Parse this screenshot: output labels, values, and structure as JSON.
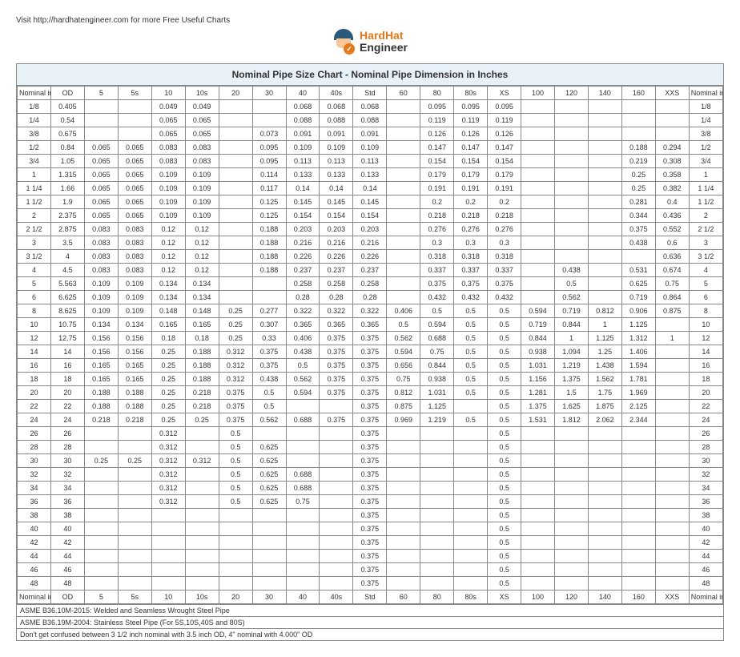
{
  "visit_text": "Visit http://hardhatengineer.com for more Free Useful Charts",
  "logo": {
    "line1": "HardHat",
    "line2": "Engineer"
  },
  "title": "Nominal Pipe Size Chart - Nominal Pipe Dimension in Inches",
  "headers": [
    "Nominal in Inch",
    "OD",
    "5",
    "5s",
    "10",
    "10s",
    "20",
    "30",
    "40",
    "40s",
    "Std",
    "60",
    "80",
    "80s",
    "XS",
    "100",
    "120",
    "140",
    "160",
    "XXS",
    "Nominal in Inch"
  ],
  "rows": [
    [
      "1/8",
      "0.405",
      "",
      "",
      "0.049",
      "0.049",
      "",
      "",
      "0.068",
      "0.068",
      "0.068",
      "",
      "0.095",
      "0.095",
      "0.095",
      "",
      "",
      "",
      "",
      "",
      "1/8"
    ],
    [
      "1/4",
      "0.54",
      "",
      "",
      "0.065",
      "0.065",
      "",
      "",
      "0.088",
      "0.088",
      "0.088",
      "",
      "0.119",
      "0.119",
      "0.119",
      "",
      "",
      "",
      "",
      "",
      "1/4"
    ],
    [
      "3/8",
      "0.675",
      "",
      "",
      "0.065",
      "0.065",
      "",
      "0.073",
      "0.091",
      "0.091",
      "0.091",
      "",
      "0.126",
      "0.126",
      "0.126",
      "",
      "",
      "",
      "",
      "",
      "3/8"
    ],
    [
      "1/2",
      "0.84",
      "0.065",
      "0.065",
      "0.083",
      "0.083",
      "",
      "0.095",
      "0.109",
      "0.109",
      "0.109",
      "",
      "0.147",
      "0.147",
      "0.147",
      "",
      "",
      "",
      "0.188",
      "0.294",
      "1/2"
    ],
    [
      "3/4",
      "1.05",
      "0.065",
      "0.065",
      "0.083",
      "0.083",
      "",
      "0.095",
      "0.113",
      "0.113",
      "0.113",
      "",
      "0.154",
      "0.154",
      "0.154",
      "",
      "",
      "",
      "0.219",
      "0.308",
      "3/4"
    ],
    [
      "1",
      "1.315",
      "0.065",
      "0.065",
      "0.109",
      "0.109",
      "",
      "0.114",
      "0.133",
      "0.133",
      "0.133",
      "",
      "0.179",
      "0.179",
      "0.179",
      "",
      "",
      "",
      "0.25",
      "0.358",
      "1"
    ],
    [
      "1 1/4",
      "1.66",
      "0.065",
      "0.065",
      "0.109",
      "0.109",
      "",
      "0.117",
      "0.14",
      "0.14",
      "0.14",
      "",
      "0.191",
      "0.191",
      "0.191",
      "",
      "",
      "",
      "0.25",
      "0.382",
      "1 1/4"
    ],
    [
      "1 1/2",
      "1.9",
      "0.065",
      "0.065",
      "0.109",
      "0.109",
      "",
      "0.125",
      "0.145",
      "0.145",
      "0.145",
      "",
      "0.2",
      "0.2",
      "0.2",
      "",
      "",
      "",
      "0.281",
      "0.4",
      "1 1/2"
    ],
    [
      "2",
      "2.375",
      "0.065",
      "0.065",
      "0.109",
      "0.109",
      "",
      "0.125",
      "0.154",
      "0.154",
      "0.154",
      "",
      "0.218",
      "0.218",
      "0.218",
      "",
      "",
      "",
      "0.344",
      "0.436",
      "2"
    ],
    [
      "2 1/2",
      "2.875",
      "0.083",
      "0.083",
      "0.12",
      "0.12",
      "",
      "0.188",
      "0.203",
      "0.203",
      "0.203",
      "",
      "0.276",
      "0.276",
      "0.276",
      "",
      "",
      "",
      "0.375",
      "0.552",
      "2 1/2"
    ],
    [
      "3",
      "3.5",
      "0.083",
      "0.083",
      "0.12",
      "0.12",
      "",
      "0.188",
      "0.216",
      "0.216",
      "0.216",
      "",
      "0.3",
      "0.3",
      "0.3",
      "",
      "",
      "",
      "0.438",
      "0.6",
      "3"
    ],
    [
      "3 1/2",
      "4",
      "0.083",
      "0.083",
      "0.12",
      "0.12",
      "",
      "0.188",
      "0.226",
      "0.226",
      "0.226",
      "",
      "0.318",
      "0.318",
      "0.318",
      "",
      "",
      "",
      "",
      "0.636",
      "3 1/2"
    ],
    [
      "4",
      "4.5",
      "0.083",
      "0.083",
      "0.12",
      "0.12",
      "",
      "0.188",
      "0.237",
      "0.237",
      "0.237",
      "",
      "0.337",
      "0.337",
      "0.337",
      "",
      "0.438",
      "",
      "0.531",
      "0.674",
      "4"
    ],
    [
      "5",
      "5.563",
      "0.109",
      "0.109",
      "0.134",
      "0.134",
      "",
      "",
      "0.258",
      "0.258",
      "0.258",
      "",
      "0.375",
      "0.375",
      "0.375",
      "",
      "0.5",
      "",
      "0.625",
      "0.75",
      "5"
    ],
    [
      "6",
      "6.625",
      "0.109",
      "0.109",
      "0.134",
      "0.134",
      "",
      "",
      "0.28",
      "0.28",
      "0.28",
      "",
      "0.432",
      "0.432",
      "0.432",
      "",
      "0.562",
      "",
      "0.719",
      "0.864",
      "6"
    ],
    [
      "8",
      "8.625",
      "0.109",
      "0.109",
      "0.148",
      "0.148",
      "0.25",
      "0.277",
      "0.322",
      "0.322",
      "0.322",
      "0.406",
      "0.5",
      "0.5",
      "0.5",
      "0.594",
      "0.719",
      "0.812",
      "0.906",
      "0.875",
      "8"
    ],
    [
      "10",
      "10.75",
      "0.134",
      "0.134",
      "0.165",
      "0.165",
      "0.25",
      "0.307",
      "0.365",
      "0.365",
      "0.365",
      "0.5",
      "0.594",
      "0.5",
      "0.5",
      "0.719",
      "0.844",
      "1",
      "1.125",
      "",
      "10"
    ],
    [
      "12",
      "12.75",
      "0.156",
      "0.156",
      "0.18",
      "0.18",
      "0.25",
      "0.33",
      "0.406",
      "0.375",
      "0.375",
      "0.562",
      "0.688",
      "0.5",
      "0.5",
      "0.844",
      "1",
      "1.125",
      "1.312",
      "1",
      "12"
    ],
    [
      "14",
      "14",
      "0.156",
      "0.156",
      "0.25",
      "0.188",
      "0.312",
      "0.375",
      "0.438",
      "0.375",
      "0.375",
      "0.594",
      "0.75",
      "0.5",
      "0.5",
      "0.938",
      "1.094",
      "1.25",
      "1.406",
      "",
      "14"
    ],
    [
      "16",
      "16",
      "0.165",
      "0.165",
      "0.25",
      "0.188",
      "0.312",
      "0.375",
      "0.5",
      "0.375",
      "0.375",
      "0.656",
      "0.844",
      "0.5",
      "0.5",
      "1.031",
      "1.219",
      "1.438",
      "1.594",
      "",
      "16"
    ],
    [
      "18",
      "18",
      "0.165",
      "0.165",
      "0.25",
      "0.188",
      "0.312",
      "0.438",
      "0.562",
      "0.375",
      "0.375",
      "0.75",
      "0.938",
      "0.5",
      "0.5",
      "1.156",
      "1.375",
      "1.562",
      "1.781",
      "",
      "18"
    ],
    [
      "20",
      "20",
      "0.188",
      "0.188",
      "0.25",
      "0.218",
      "0.375",
      "0.5",
      "0.594",
      "0.375",
      "0.375",
      "0.812",
      "1.031",
      "0.5",
      "0.5",
      "1.281",
      "1.5",
      "1.75",
      "1.969",
      "",
      "20"
    ],
    [
      "22",
      "22",
      "0.188",
      "0.188",
      "0.25",
      "0.218",
      "0.375",
      "0.5",
      "",
      "",
      "0.375",
      "0.875",
      "1.125",
      "",
      "0.5",
      "1.375",
      "1.625",
      "1.875",
      "2.125",
      "",
      "22"
    ],
    [
      "24",
      "24",
      "0.218",
      "0.218",
      "0.25",
      "0.25",
      "0.375",
      "0.562",
      "0.688",
      "0.375",
      "0.375",
      "0.969",
      "1.219",
      "0.5",
      "0.5",
      "1.531",
      "1.812",
      "2.062",
      "2.344",
      "",
      "24"
    ],
    [
      "26",
      "26",
      "",
      "",
      "0.312",
      "",
      "0.5",
      "",
      "",
      "",
      "0.375",
      "",
      "",
      "",
      "0.5",
      "",
      "",
      "",
      "",
      "",
      "26"
    ],
    [
      "28",
      "28",
      "",
      "",
      "0.312",
      "",
      "0.5",
      "0.625",
      "",
      "",
      "0.375",
      "",
      "",
      "",
      "0.5",
      "",
      "",
      "",
      "",
      "",
      "28"
    ],
    [
      "30",
      "30",
      "0.25",
      "0.25",
      "0.312",
      "0.312",
      "0.5",
      "0.625",
      "",
      "",
      "0.375",
      "",
      "",
      "",
      "0.5",
      "",
      "",
      "",
      "",
      "",
      "30"
    ],
    [
      "32",
      "32",
      "",
      "",
      "0.312",
      "",
      "0.5",
      "0.625",
      "0.688",
      "",
      "0.375",
      "",
      "",
      "",
      "0.5",
      "",
      "",
      "",
      "",
      "",
      "32"
    ],
    [
      "34",
      "34",
      "",
      "",
      "0.312",
      "",
      "0.5",
      "0.625",
      "0.688",
      "",
      "0.375",
      "",
      "",
      "",
      "0.5",
      "",
      "",
      "",
      "",
      "",
      "34"
    ],
    [
      "36",
      "36",
      "",
      "",
      "0.312",
      "",
      "0.5",
      "0.625",
      "0.75",
      "",
      "0.375",
      "",
      "",
      "",
      "0.5",
      "",
      "",
      "",
      "",
      "",
      "36"
    ],
    [
      "38",
      "38",
      "",
      "",
      "",
      "",
      "",
      "",
      "",
      "",
      "0.375",
      "",
      "",
      "",
      "0.5",
      "",
      "",
      "",
      "",
      "",
      "38"
    ],
    [
      "40",
      "40",
      "",
      "",
      "",
      "",
      "",
      "",
      "",
      "",
      "0.375",
      "",
      "",
      "",
      "0.5",
      "",
      "",
      "",
      "",
      "",
      "40"
    ],
    [
      "42",
      "42",
      "",
      "",
      "",
      "",
      "",
      "",
      "",
      "",
      "0.375",
      "",
      "",
      "",
      "0.5",
      "",
      "",
      "",
      "",
      "",
      "42"
    ],
    [
      "44",
      "44",
      "",
      "",
      "",
      "",
      "",
      "",
      "",
      "",
      "0.375",
      "",
      "",
      "",
      "0.5",
      "",
      "",
      "",
      "",
      "",
      "44"
    ],
    [
      "46",
      "46",
      "",
      "",
      "",
      "",
      "",
      "",
      "",
      "",
      "0.375",
      "",
      "",
      "",
      "0.5",
      "",
      "",
      "",
      "",
      "",
      "46"
    ],
    [
      "48",
      "48",
      "",
      "",
      "",
      "",
      "",
      "",
      "",
      "",
      "0.375",
      "",
      "",
      "",
      "0.5",
      "",
      "",
      "",
      "",
      "",
      "48"
    ]
  ],
  "notes": [
    "ASME B36.10M-2015: Welded and Seamless Wrought Steel Pipe",
    "ASME B36.19M-2004: Stainless Steel Pipe (For 5S,10S,40S and 80S)",
    "Don't get confused between 3 1/2 inch nominal with 3.5 inch OD, 4\" nominal with 4.000\" OD"
  ],
  "chart_data": {
    "type": "table",
    "title": "Nominal Pipe Size Chart - Nominal Pipe Dimension in Inches"
  }
}
